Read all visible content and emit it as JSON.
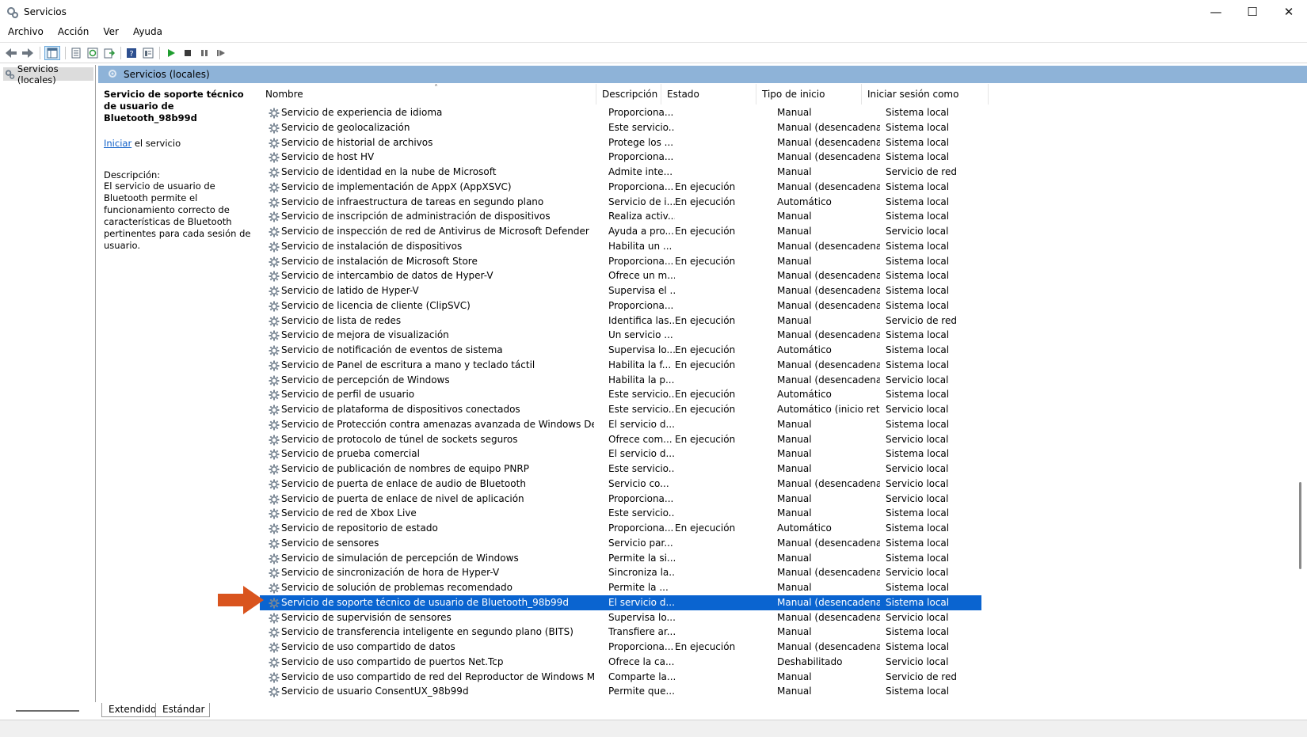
{
  "window": {
    "title": "Servicios"
  },
  "menu": [
    "Archivo",
    "Acción",
    "Ver",
    "Ayuda"
  ],
  "tree": {
    "root_label": "Servicios (locales)"
  },
  "main_header": {
    "title": "Servicios (locales)"
  },
  "detail": {
    "service_title": "Servicio de soporte técnico de usuario de Bluetooth_98b99d",
    "action_link": "Iniciar",
    "action_rest": " el servicio",
    "description_label": "Descripción:",
    "description_text": "El servicio de usuario de Bluetooth permite el funcionamiento correcto de características de Bluetooth pertinentes para cada sesión de usuario."
  },
  "columns": {
    "name": "Nombre",
    "description": "Descripción",
    "state": "Estado",
    "startup": "Tipo de inicio",
    "logon": "Iniciar sesión como"
  },
  "selected_index": 33,
  "rows": [
    {
      "name": "Servicio de experiencia de idioma",
      "description": "Proporciona...",
      "state": "",
      "startup": "Manual",
      "logon": "Sistema local"
    },
    {
      "name": "Servicio de geolocalización",
      "description": "Este servicio...",
      "state": "",
      "startup": "Manual (desencadenar...",
      "logon": "Sistema local"
    },
    {
      "name": "Servicio de historial de archivos",
      "description": "Protege los ...",
      "state": "",
      "startup": "Manual (desencadenar...",
      "logon": "Sistema local"
    },
    {
      "name": "Servicio de host HV",
      "description": "Proporciona...",
      "state": "",
      "startup": "Manual (desencadenar...",
      "logon": "Sistema local"
    },
    {
      "name": "Servicio de identidad en la nube de Microsoft",
      "description": "Admite inte...",
      "state": "",
      "startup": "Manual",
      "logon": "Servicio de red"
    },
    {
      "name": "Servicio de implementación de AppX (AppXSVC)",
      "description": "Proporciona...",
      "state": "En ejecución",
      "startup": "Manual (desencadenar...",
      "logon": "Sistema local"
    },
    {
      "name": "Servicio de infraestructura de tareas en segundo plano",
      "description": "Servicio de i...",
      "state": "En ejecución",
      "startup": "Automático",
      "logon": "Sistema local"
    },
    {
      "name": "Servicio de inscripción de administración de dispositivos",
      "description": "Realiza activ...",
      "state": "",
      "startup": "Manual",
      "logon": "Sistema local"
    },
    {
      "name": "Servicio de inspección de red de Antivirus de Microsoft Defender",
      "description": "Ayuda a pro...",
      "state": "En ejecución",
      "startup": "Manual",
      "logon": "Servicio local"
    },
    {
      "name": "Servicio de instalación de dispositivos",
      "description": "Habilita un ...",
      "state": "",
      "startup": "Manual (desencadenar...",
      "logon": "Sistema local"
    },
    {
      "name": "Servicio de instalación de Microsoft Store",
      "description": "Proporciona...",
      "state": "En ejecución",
      "startup": "Manual",
      "logon": "Sistema local"
    },
    {
      "name": "Servicio de intercambio de datos de Hyper-V",
      "description": "Ofrece un m...",
      "state": "",
      "startup": "Manual (desencadenar...",
      "logon": "Sistema local"
    },
    {
      "name": "Servicio de latido de Hyper-V",
      "description": "Supervisa el ...",
      "state": "",
      "startup": "Manual (desencadenar...",
      "logon": "Sistema local"
    },
    {
      "name": "Servicio de licencia de cliente (ClipSVC)",
      "description": "Proporciona...",
      "state": "",
      "startup": "Manual (desencadenar...",
      "logon": "Sistema local"
    },
    {
      "name": "Servicio de lista de redes",
      "description": "Identifica las...",
      "state": "En ejecución",
      "startup": "Manual",
      "logon": "Servicio de red"
    },
    {
      "name": "Servicio de mejora de visualización",
      "description": "Un servicio ...",
      "state": "",
      "startup": "Manual (desencadenar...",
      "logon": "Sistema local"
    },
    {
      "name": "Servicio de notificación de eventos de sistema",
      "description": "Supervisa lo...",
      "state": "En ejecución",
      "startup": "Automático",
      "logon": "Sistema local"
    },
    {
      "name": "Servicio de Panel de escritura a mano y teclado táctil",
      "description": "Habilita la f...",
      "state": "En ejecución",
      "startup": "Manual (desencadenar...",
      "logon": "Sistema local"
    },
    {
      "name": "Servicio de percepción de Windows",
      "description": "Habilita la p...",
      "state": "",
      "startup": "Manual (desencadenar...",
      "logon": "Servicio local"
    },
    {
      "name": "Servicio de perfil de usuario",
      "description": "Este servicio...",
      "state": "En ejecución",
      "startup": "Automático",
      "logon": "Sistema local"
    },
    {
      "name": "Servicio de plataforma de dispositivos conectados",
      "description": "Este servicio...",
      "state": "En ejecución",
      "startup": "Automático (inicio retr...",
      "logon": "Servicio local"
    },
    {
      "name": "Servicio de Protección contra amenazas avanzada de Windows Defender",
      "description": "El servicio d...",
      "state": "",
      "startup": "Manual",
      "logon": "Sistema local"
    },
    {
      "name": "Servicio de protocolo de túnel de sockets seguros",
      "description": "Ofrece com...",
      "state": "En ejecución",
      "startup": "Manual",
      "logon": "Servicio local"
    },
    {
      "name": "Servicio de prueba comercial",
      "description": "El servicio d...",
      "state": "",
      "startup": "Manual",
      "logon": "Sistema local"
    },
    {
      "name": "Servicio de publicación de nombres de equipo PNRP",
      "description": "Este servicio...",
      "state": "",
      "startup": "Manual",
      "logon": "Servicio local"
    },
    {
      "name": "Servicio de puerta de enlace de audio de Bluetooth",
      "description": "Servicio co...",
      "state": "",
      "startup": "Manual (desencadenar...",
      "logon": "Servicio local"
    },
    {
      "name": "Servicio de puerta de enlace de nivel de aplicación",
      "description": "Proporciona...",
      "state": "",
      "startup": "Manual",
      "logon": "Servicio local"
    },
    {
      "name": "Servicio de red de Xbox Live",
      "description": "Este servicio...",
      "state": "",
      "startup": "Manual",
      "logon": "Sistema local"
    },
    {
      "name": "Servicio de repositorio de estado",
      "description": "Proporciona...",
      "state": "En ejecución",
      "startup": "Automático",
      "logon": "Sistema local"
    },
    {
      "name": "Servicio de sensores",
      "description": "Servicio par...",
      "state": "",
      "startup": "Manual (desencadenar...",
      "logon": "Sistema local"
    },
    {
      "name": "Servicio de simulación de percepción de Windows",
      "description": "Permite la si...",
      "state": "",
      "startup": "Manual",
      "logon": "Sistema local"
    },
    {
      "name": "Servicio de sincronización de hora de Hyper-V",
      "description": "Sincroniza la...",
      "state": "",
      "startup": "Manual (desencadenar...",
      "logon": "Servicio local"
    },
    {
      "name": "Servicio de solución de problemas recomendado",
      "description": "Permite la ...",
      "state": "",
      "startup": "Manual",
      "logon": "Sistema local"
    },
    {
      "name": "Servicio de soporte técnico de usuario de Bluetooth_98b99d",
      "description": "El servicio d...",
      "state": "",
      "startup": "Manual (desencadenar...",
      "logon": "Sistema local"
    },
    {
      "name": "Servicio de supervisión de sensores",
      "description": "Supervisa lo...",
      "state": "",
      "startup": "Manual (desencadenar...",
      "logon": "Servicio local"
    },
    {
      "name": "Servicio de transferencia inteligente en segundo plano (BITS)",
      "description": "Transfiere ar...",
      "state": "",
      "startup": "Manual",
      "logon": "Sistema local"
    },
    {
      "name": "Servicio de uso compartido de datos",
      "description": "Proporciona...",
      "state": "En ejecución",
      "startup": "Manual (desencadenar...",
      "logon": "Sistema local"
    },
    {
      "name": "Servicio de uso compartido de puertos Net.Tcp",
      "description": "Ofrece la ca...",
      "state": "",
      "startup": "Deshabilitado",
      "logon": "Servicio local"
    },
    {
      "name": "Servicio de uso compartido de red del Reproductor de Windows Media",
      "description": "Comparte la...",
      "state": "",
      "startup": "Manual",
      "logon": "Servicio de red"
    },
    {
      "name": "Servicio de usuario ConsentUX_98b99d",
      "description": "Permite que...",
      "state": "",
      "startup": "Manual",
      "logon": "Sistema local"
    }
  ],
  "tabs": {
    "extended": "Extendido",
    "standard": "Estándar"
  },
  "colors": {
    "selection": "#0a64d0",
    "header_band": "#8eb3d8",
    "arrow": "#d9541e"
  },
  "icons": [
    "services-app-icon",
    "back-arrow-icon",
    "forward-arrow-icon",
    "console-tree-icon",
    "properties-icon",
    "refresh-icon",
    "export-list-icon",
    "help-icon",
    "extended-view-icon",
    "play-icon",
    "stop-icon",
    "pause-icon",
    "restart-icon",
    "gear-icon",
    "orange-arrow-pointer"
  ]
}
